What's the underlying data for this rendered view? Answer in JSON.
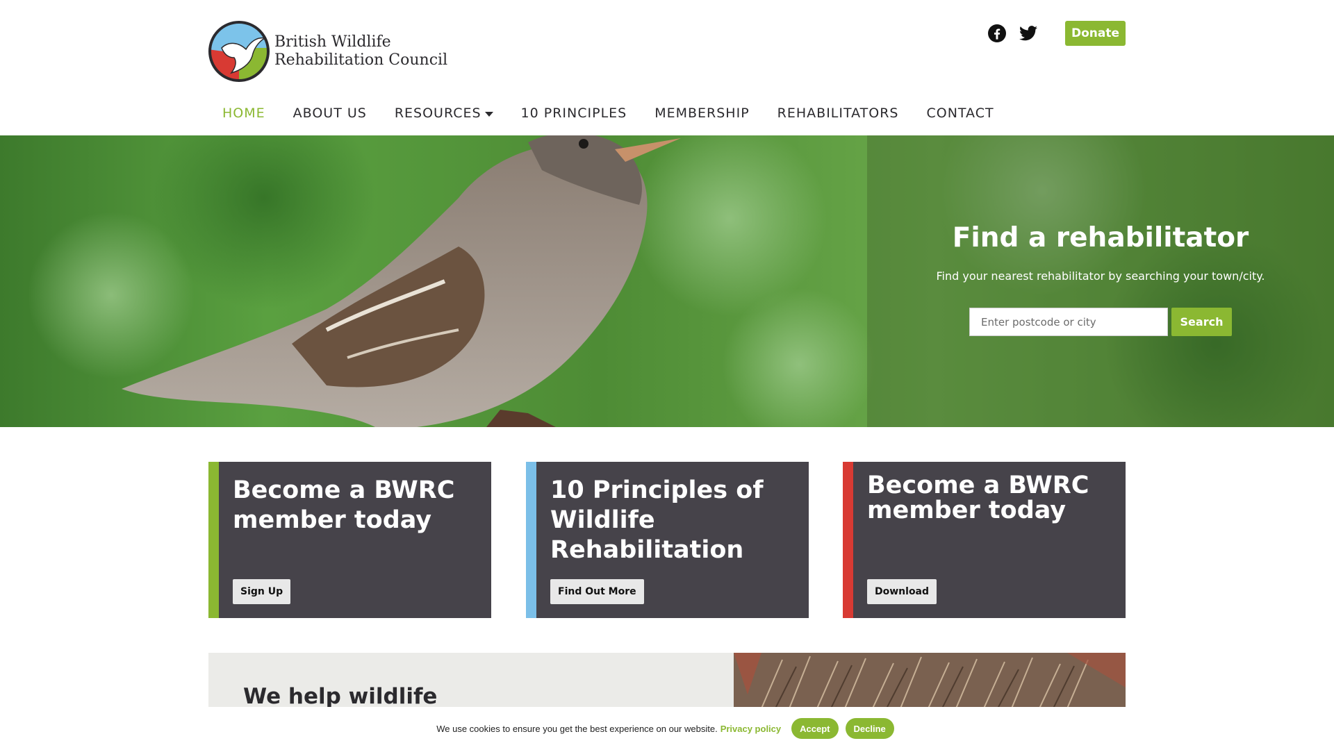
{
  "header": {
    "logo_line1": "British Wildlife",
    "logo_line2": "Rehabilitation Council",
    "donate_label": "Donate"
  },
  "social": [
    {
      "icon": "facebook-icon"
    },
    {
      "icon": "twitter-icon"
    }
  ],
  "nav": {
    "items": [
      {
        "label": "HOME",
        "active": true
      },
      {
        "label": "ABOUT US"
      },
      {
        "label": "RESOURCES",
        "dropdown": true
      },
      {
        "label": "10 PRINCIPLES"
      },
      {
        "label": "MEMBERSHIP"
      },
      {
        "label": "REHABILITATORS"
      },
      {
        "label": "CONTACT"
      }
    ]
  },
  "hero": {
    "title": "Find a rehabilitator",
    "subtitle": "Find your nearest rehabilitator by searching your town/city.",
    "search_placeholder": "Enter postcode or city",
    "search_label": "Search"
  },
  "cards": [
    {
      "title": "Become a BWRC member today",
      "button": "Sign Up",
      "accent": "#8bb832"
    },
    {
      "title": "10 Principles of Wildlife Rehabilitation",
      "button": "Find Out More",
      "accent": "#7bbfe8"
    },
    {
      "title": "Become a BWRC member today",
      "button": "Download",
      "accent": "#d83a33"
    }
  ],
  "help": {
    "title": "We help wildlife"
  },
  "cookie": {
    "text": "We use cookies to ensure you get the best experience on our website.",
    "privacy_link": "Privacy policy",
    "accept_label": "Accept",
    "decline_label": "Decline"
  },
  "colors": {
    "brand_green": "#8bb832",
    "card_bg": "#46434a",
    "text_dark": "#2b2a2e"
  }
}
